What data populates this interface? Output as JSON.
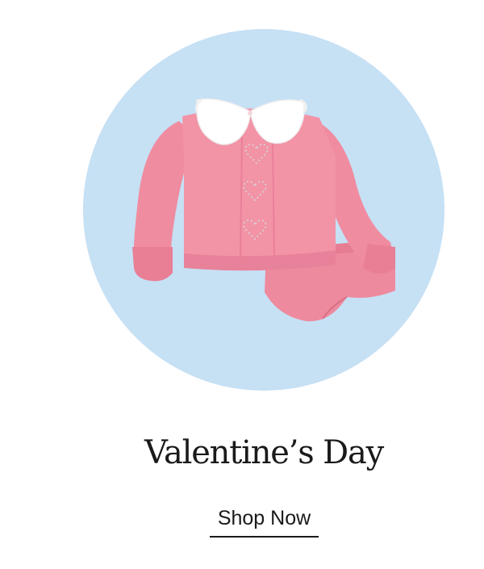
{
  "promo": {
    "title": "Valentine’s Day",
    "cta_label": "Shop Now"
  },
  "image": {
    "subject": "pink-knit-heart-sweater-set-icon"
  },
  "colors": {
    "background": "#ffffff",
    "circle": "#c6e0f4",
    "knit_pink": "#f08ca0",
    "collar": "#ffffff",
    "text": "#1a1a1a"
  }
}
